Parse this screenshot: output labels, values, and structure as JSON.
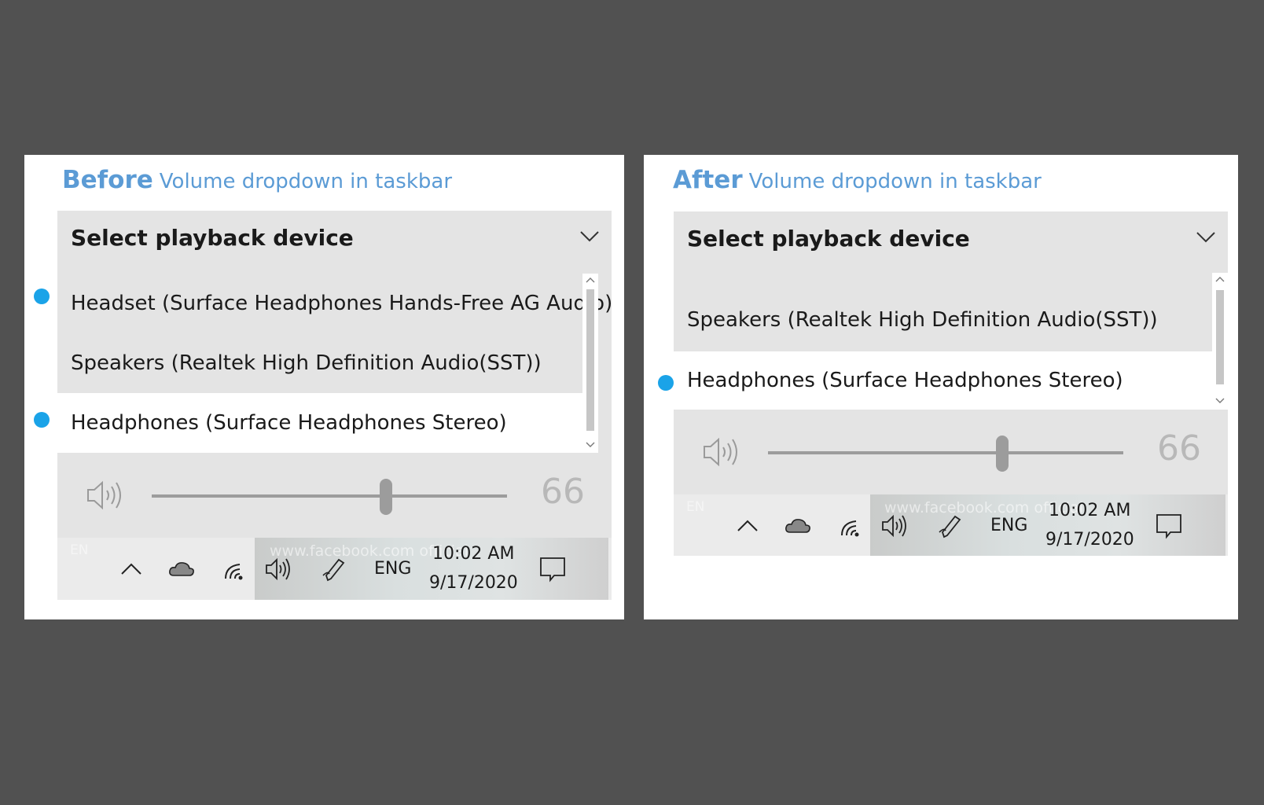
{
  "colors": {
    "background": "#515151",
    "heading_accent": "#5b9bd5",
    "selection_dot": "#1aa3e8",
    "flyout_bg": "#e4e4e4"
  },
  "before": {
    "heading_bold": "Before",
    "heading_sub": "Volume dropdown in taskbar",
    "dropdown_title": "Select playback device",
    "devices": [
      {
        "label": "Headset (Surface Headphones Hands-Free AG Audio)",
        "dot": true
      },
      {
        "label": "Speakers (Realtek High Definition Audio(SST))",
        "dot": false
      },
      {
        "label": "Headphones (Surface Headphones Stereo)",
        "dot": true
      }
    ],
    "volume_value": "66",
    "volume_fraction": 0.66,
    "taskbar": {
      "lang_small": "EN",
      "lang": "ENG",
      "time": "10:02 AM",
      "date": "9/17/2020",
      "watermark": "www.facebook.com official"
    }
  },
  "after": {
    "heading_bold": "After",
    "heading_sub": "Volume dropdown in taskbar",
    "dropdown_title": "Select playback device",
    "devices": [
      {
        "label": "Speakers (Realtek High Definition Audio(SST))",
        "dot": false
      },
      {
        "label": "Headphones (Surface Headphones Stereo)",
        "dot": true
      }
    ],
    "volume_value": "66",
    "volume_fraction": 0.66,
    "taskbar": {
      "lang_small": "EN",
      "lang": "ENG",
      "time": "10:02 AM",
      "date": "9/17/2020",
      "watermark": "www.facebook.com official"
    }
  },
  "icons": [
    "chevron-down-icon",
    "scroll-up-icon",
    "scroll-down-icon",
    "speaker-icon",
    "chevron-up-icon",
    "onedrive-cloud-icon",
    "wifi-icon",
    "volume-icon",
    "pen-icon",
    "notification-icon"
  ]
}
